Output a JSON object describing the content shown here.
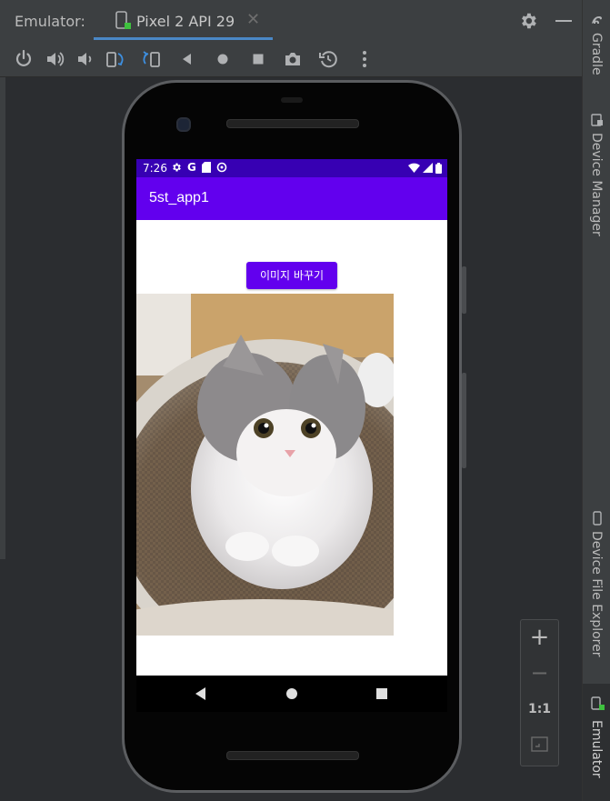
{
  "header": {
    "title": "Emulator:",
    "device_tab": "Pixel 2 API 29",
    "close_glyph": "✕"
  },
  "right_tabs": {
    "gradle": "Gradle",
    "device_manager": "Device Manager",
    "device_file_explorer": "Device File Explorer",
    "emulator": "Emulator"
  },
  "phone_screen": {
    "status_time": "7:26",
    "status_g": "G",
    "app_title": "5st_app1",
    "change_button_label": "이미지 바꾸기"
  },
  "zoom": {
    "zoom_in": "+",
    "zoom_out": "−",
    "actual_size": "1:1"
  },
  "colors": {
    "status_bar": "#3700b3",
    "app_bar": "#6200ee",
    "tab_underline": "#4a88c7",
    "ide_panel": "#3c3f41"
  },
  "icons": {
    "toolbar": [
      "power-icon",
      "volume-up-icon",
      "volume-down-icon",
      "rotate-left-icon",
      "rotate-right-icon",
      "back-icon",
      "home-icon",
      "overview-icon",
      "screenshot-icon",
      "snapshot-icon",
      "more-icon"
    ],
    "phone_nav": [
      "nav-back-icon",
      "nav-home-icon",
      "nav-recents-icon"
    ]
  }
}
